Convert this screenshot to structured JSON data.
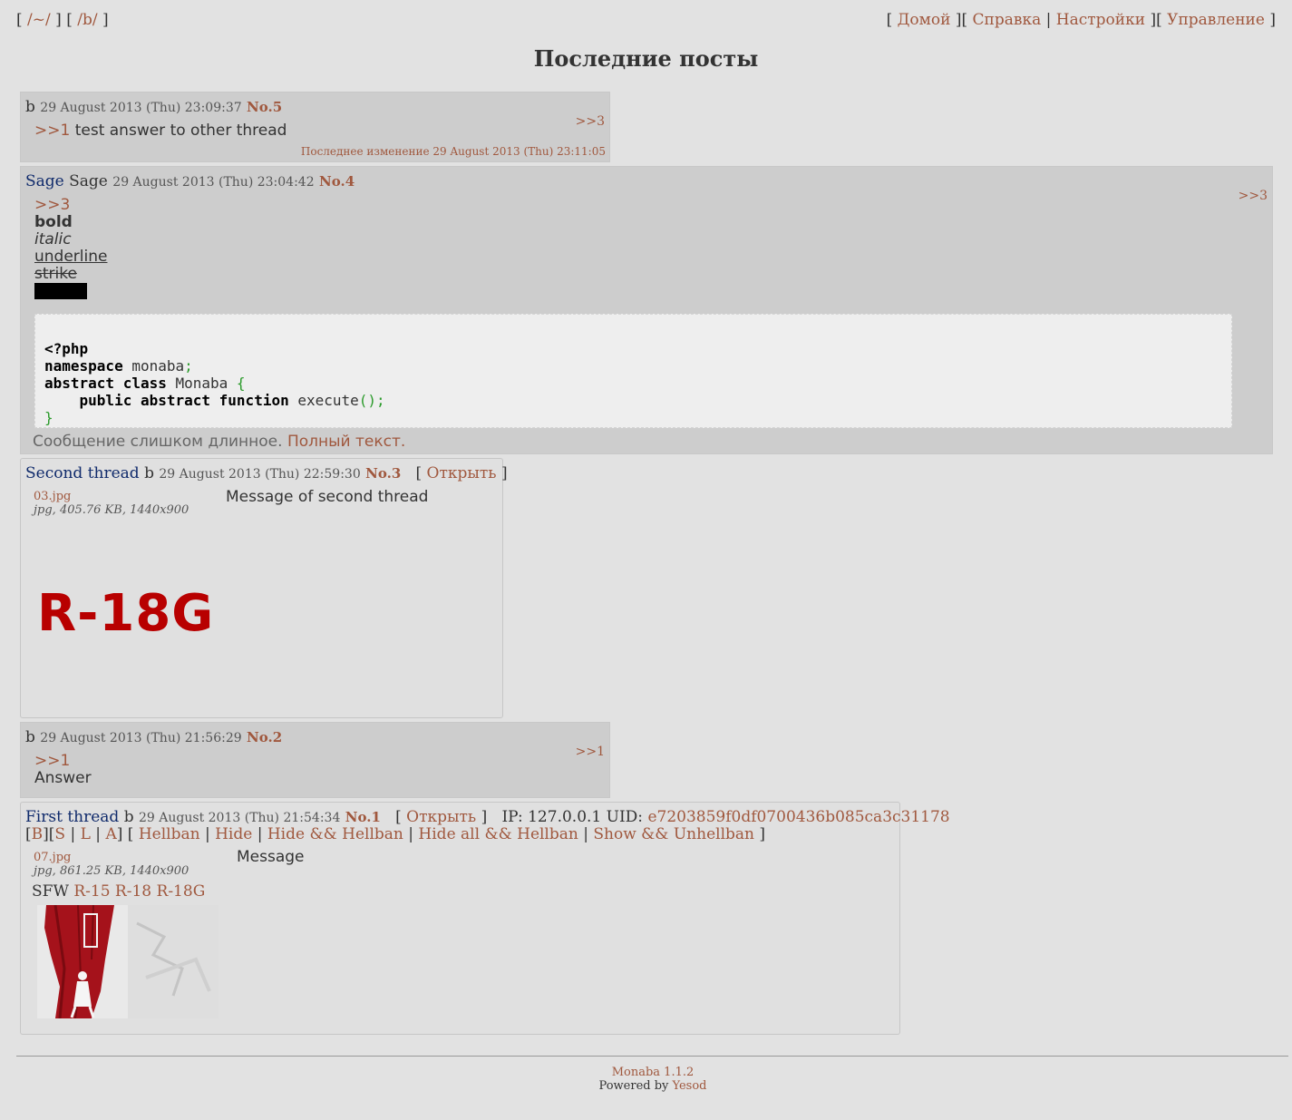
{
  "nav": {
    "left": [
      {
        "label": "/~/"
      },
      {
        "label": "/b/"
      }
    ],
    "right": [
      {
        "label": "Домой"
      },
      {
        "label": "Справка"
      },
      {
        "label": "Настройки"
      },
      {
        "label": "Управление"
      }
    ]
  },
  "page_title": "Последние посты",
  "posts": {
    "p5": {
      "name": "b",
      "date": "29 August 2013 (Thu) 23:09:37",
      "no": "No.5",
      "backref": ">>3",
      "quote": ">>1",
      "text": "test answer to other thread",
      "edited": "Последнее изменение 29 August 2013 (Thu) 23:11:05"
    },
    "p4": {
      "subject": "Sage",
      "name": "Sage",
      "date": "29 August 2013 (Thu) 23:04:42",
      "no": "No.4",
      "backref": ">>3",
      "quote": ">>3",
      "bold": "bold",
      "italic": "italic",
      "underline": "underline",
      "strike": "strike",
      "code": {
        "l1": "<?php",
        "l2_kw": "namespace",
        "l2_rest": " monaba",
        "l2_p": ";",
        "l3_kw": "abstract class",
        "l3_rest": " Monaba ",
        "l3_p": "{",
        "l4_indent": "    ",
        "l4_kw": "public abstract function",
        "l4_rest": " execute",
        "l4_p": "();",
        "l5_p": "}"
      },
      "too_long": "Сообщение слишком длинное.",
      "full_text": "Полный текст."
    },
    "p3": {
      "subject": "Second thread",
      "name": "b",
      "date": "29 August 2013 (Thu) 22:59:30",
      "no": "No.3",
      "open": "Открыть",
      "file_name": "03.jpg",
      "file_meta": "jpg, 405.76 KB, 1440x900",
      "censor": "R-18G",
      "text": "Message of second thread"
    },
    "p2": {
      "name": "b",
      "date": "29 August 2013 (Thu) 21:56:29",
      "no": "No.2",
      "backref": ">>1",
      "quote": ">>1",
      "text": "Answer"
    },
    "p1": {
      "subject": "First thread",
      "name": "b",
      "date": "29 August 2013 (Thu) 21:54:34",
      "no": "No.1",
      "open": "Открыть",
      "ip": "IP: 127.0.0.1 UID:",
      "uid": "e7203859f0df0700436b085ca3c31178",
      "mod": {
        "b": "B",
        "s": "S",
        "l": "L",
        "a": "A",
        "hellban": "Hellban",
        "hide": "Hide",
        "hide_hellban": "Hide && Hellban",
        "hide_all_hellban": "Hide all && Hellban",
        "show_unhellban": "Show && Unhellban"
      },
      "file_name": "07.jpg",
      "file_meta": "jpg, 861.25 KB, 1440x900",
      "rating": {
        "sfw": "SFW",
        "r15": "R-15",
        "r18": "R-18",
        "r18g": "R-18G"
      },
      "text": "Message"
    }
  },
  "footer": {
    "version": "Monaba 1.1.2",
    "powered": "Powered by",
    "yesod": "Yesod"
  }
}
